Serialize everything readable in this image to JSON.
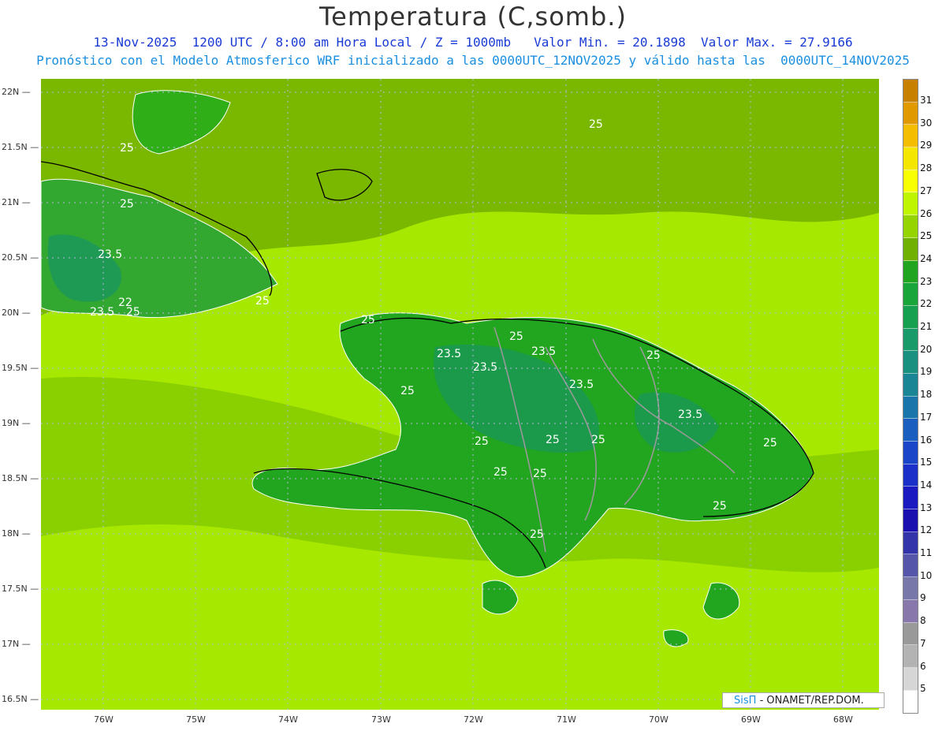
{
  "header": {
    "title": "Temperatura (C,somb.)",
    "line1": "13-Nov-2025  1200 UTC / 8:00 am Hora Local / Z = 1000mb   Valor Min. = 20.1898  Valor Max. = 27.9166",
    "line2": "Pronóstico con el Modelo Atmosferico WRF inicializado a las 0000UTC_12NOV2025 y válido hasta las  0000UTC_14NOV2025"
  },
  "axes": {
    "lat_labels": [
      "22N",
      "21.5N",
      "21N",
      "20.5N",
      "20N",
      "19.5N",
      "19N",
      "18.5N",
      "18N",
      "17.5N",
      "17N",
      "16.5N"
    ],
    "lon_labels": [
      "76W",
      "75W",
      "74W",
      "73W",
      "72W",
      "71W",
      "70W",
      "69W",
      "68W"
    ]
  },
  "contour_labels": [
    "25",
    "25",
    "25",
    "23.5",
    "22",
    "23.5",
    "25",
    "25",
    "25",
    "25",
    "23.5",
    "23.5",
    "23.5",
    "25",
    "25",
    "23.5",
    "23.5",
    "25",
    "25",
    "25",
    "25",
    "25",
    "25",
    "25",
    "25"
  ],
  "legend": {
    "values": [
      "31",
      "30",
      "29",
      "28",
      "27",
      "26",
      "25",
      "24",
      "23",
      "22",
      "21",
      "20",
      "19",
      "18",
      "17",
      "16",
      "15",
      "14",
      "13",
      "12",
      "11",
      "10",
      "9",
      "8",
      "7",
      "6",
      "5"
    ],
    "colors": [
      "#c78000",
      "#e09a00",
      "#f5bd00",
      "#f5e600",
      "#f8ff00",
      "#bff500",
      "#95d400",
      "#6fb000",
      "#21a521",
      "#1aa53a",
      "#17a050",
      "#199a6a",
      "#1a9080",
      "#1a8595",
      "#1a75aa",
      "#1a5fc0",
      "#1a45c8",
      "#1a30c8",
      "#1a1ac0",
      "#1a10b0",
      "#3333aa",
      "#5555aa",
      "#7777aa",
      "#8877aa",
      "#999999",
      "#b3b3b3",
      "#d6d6d6",
      "#ffffff"
    ]
  },
  "credit": {
    "logo": "SisΠ",
    "text": "- ONAMET/REP.DOM."
  }
}
